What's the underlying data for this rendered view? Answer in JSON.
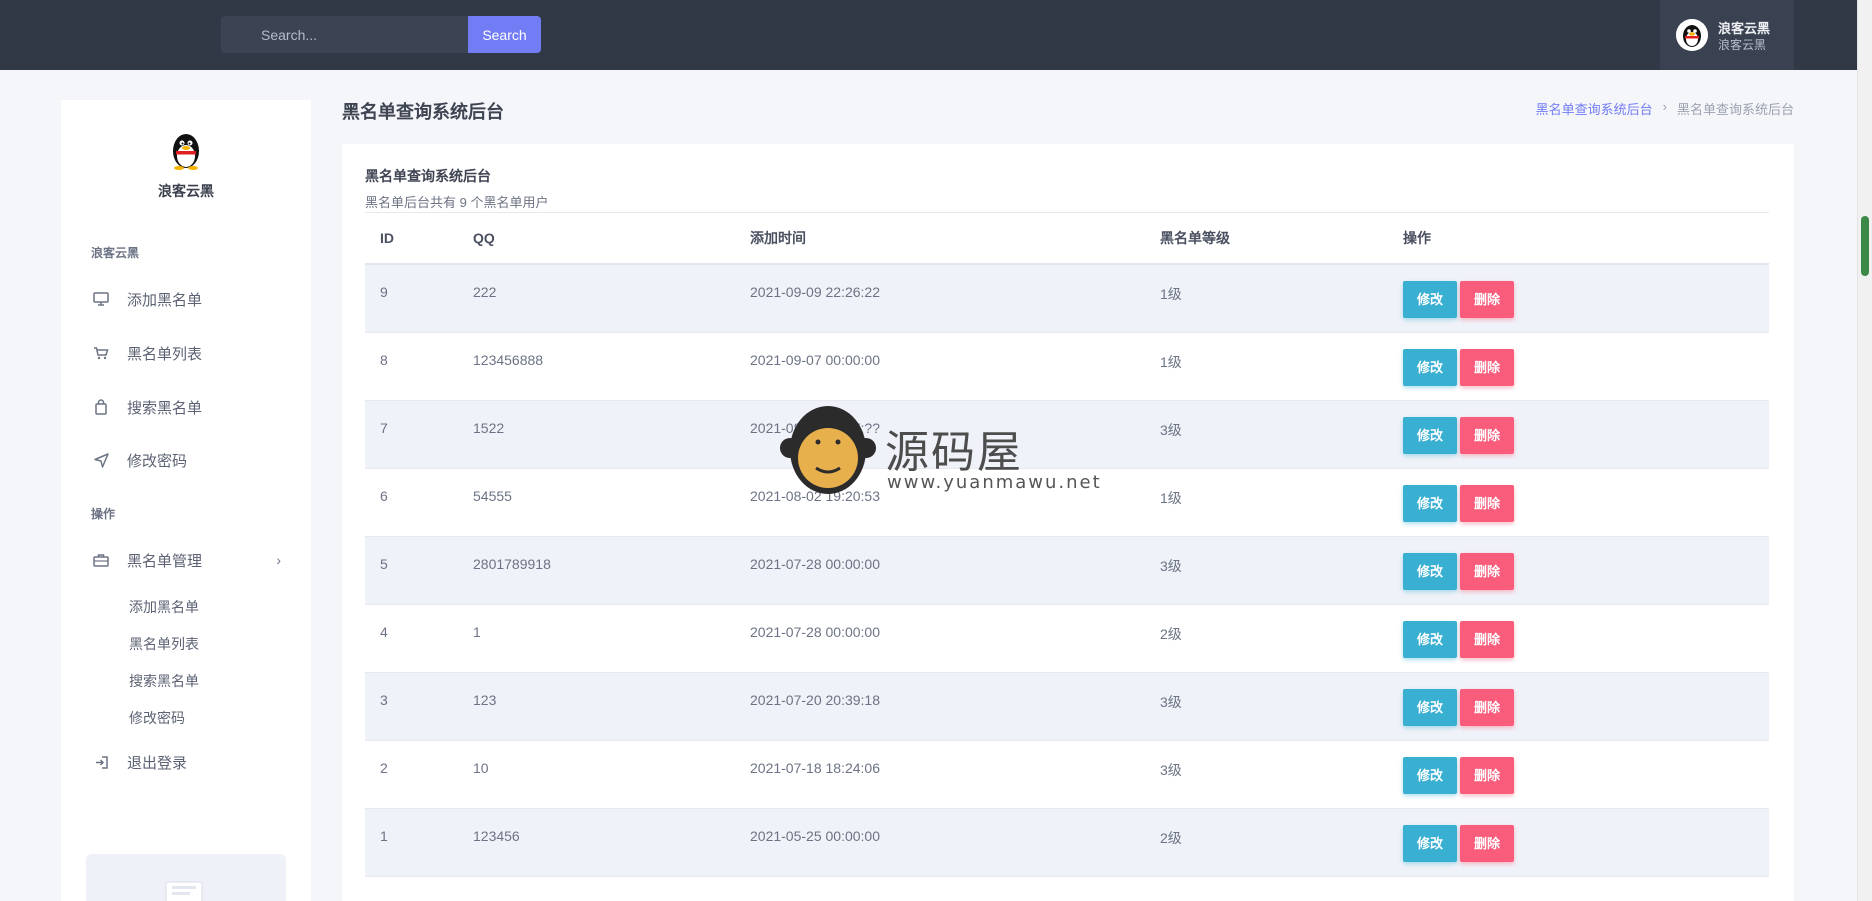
{
  "header": {
    "search_placeholder": "Search...",
    "search_button": "Search",
    "user_name": "浪客云黑",
    "user_subtitle": "浪客云黑"
  },
  "sidebar": {
    "brand": "浪客云黑",
    "section1": "浪客云黑",
    "items": [
      {
        "label": "添加黑名单",
        "icon": "monitor-icon"
      },
      {
        "label": "黑名单列表",
        "icon": "cart-icon"
      },
      {
        "label": "搜索黑名单",
        "icon": "bag-icon"
      },
      {
        "label": "修改密码",
        "icon": "send-icon"
      }
    ],
    "section2": "操作",
    "group": {
      "label": "黑名单管理",
      "icon": "briefcase-icon"
    },
    "sub_items": [
      "添加黑名单",
      "黑名单列表",
      "搜索黑名单",
      "修改密码"
    ],
    "logout": {
      "label": "退出登录",
      "icon": "logout-icon"
    }
  },
  "page": {
    "title": "黑名单查询系统后台",
    "breadcrumb": [
      "黑名单查询系统后台",
      "黑名单查询系统后台"
    ]
  },
  "card": {
    "title": "黑名单查询系统后台",
    "subtitle": "黑名单后台共有 9 个黑名单用户"
  },
  "table": {
    "headers": [
      "ID",
      "QQ",
      "添加时间",
      "黑名单等级",
      "操作"
    ],
    "rows": [
      [
        "9",
        "222",
        "2021-09-09 22:26:22",
        "1级"
      ],
      [
        "8",
        "123456888",
        "2021-09-07 00:00:00",
        "1级"
      ],
      [
        "7",
        "1522",
        "2021-08-31 20:27:??",
        "3级"
      ],
      [
        "6",
        "54555",
        "2021-08-02 19:20:53",
        "1级"
      ],
      [
        "5",
        "2801789918",
        "2021-07-28 00:00:00",
        "3级"
      ],
      [
        "4",
        "1",
        "2021-07-28 00:00:00",
        "2级"
      ],
      [
        "3",
        "123",
        "2021-07-20 20:39:18",
        "3级"
      ],
      [
        "2",
        "10",
        "2021-07-18 18:24:06",
        "3级"
      ],
      [
        "1",
        "123456",
        "2021-05-25 00:00:00",
        "2级"
      ]
    ],
    "edit_label": "修改",
    "delete_label": "删除"
  },
  "watermark": {
    "text": "源码屋",
    "url": "www.yuanmawu.net"
  },
  "colors": {
    "topbar": "#313846",
    "primary": "#727cf5",
    "edit": "#39afd1",
    "delete": "#fa5c7c"
  }
}
